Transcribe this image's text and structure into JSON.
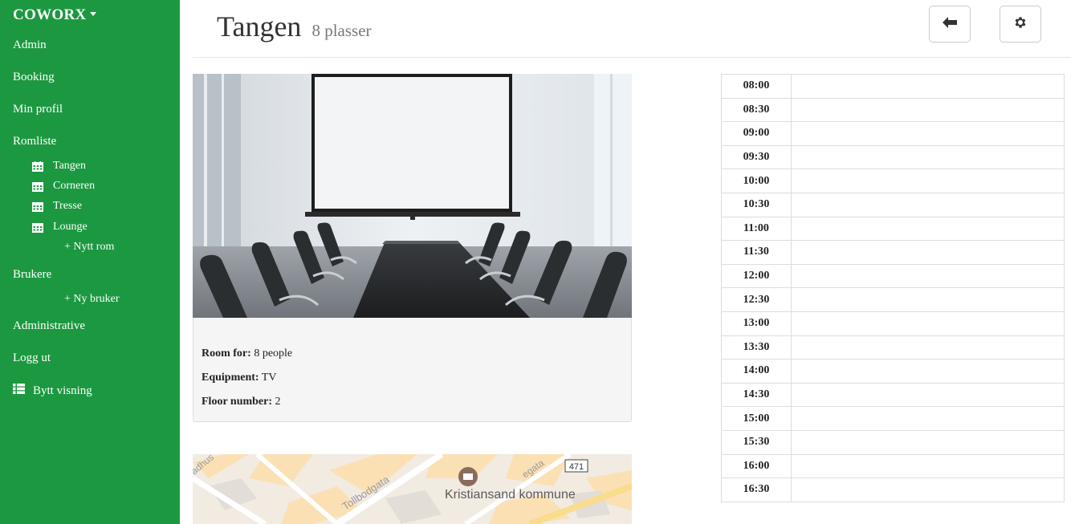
{
  "sidebar": {
    "brand": "COWORX",
    "admin": "Admin",
    "booking": "Booking",
    "profile": "Min profil",
    "roomlist": "Romliste",
    "rooms": [
      "Tangen",
      "Corneren",
      "Tresse",
      "Lounge"
    ],
    "new_room": "+ Nytt rom",
    "users": "Brukere",
    "new_user": "+ Ny bruker",
    "administrative": "Administrative",
    "logout": "Logg ut",
    "switch_view": "Bytt visning"
  },
  "header": {
    "title": "Tangen",
    "subtitle": "8 plasser"
  },
  "room": {
    "capacity_label": "Room for:",
    "capacity_value": "8 people",
    "equipment_label": "Equipment:",
    "equipment_value": "TV",
    "floor_label": "Floor number:",
    "floor_value": "2"
  },
  "map": {
    "place_label": "Kristiansand kommune",
    "street_1": "Tollbodgata",
    "street_2": "adhus",
    "street_3": "egata",
    "road_number": "471"
  },
  "schedule": {
    "times": [
      "08:00",
      "08:30",
      "09:00",
      "09:30",
      "10:00",
      "10:30",
      "11:00",
      "11:30",
      "12:00",
      "12:30",
      "13:00",
      "13:30",
      "14:00",
      "14:30",
      "15:00",
      "15:30",
      "16:00",
      "16:30"
    ]
  },
  "colors": {
    "sidebar_bg": "#1c9840",
    "panel_bg": "#f5f5f5",
    "border": "#dddddd"
  },
  "icons": {
    "back": "arrow-left-icon",
    "settings": "gear-icon",
    "room": "calendar-icon",
    "switch": "list-icon"
  }
}
